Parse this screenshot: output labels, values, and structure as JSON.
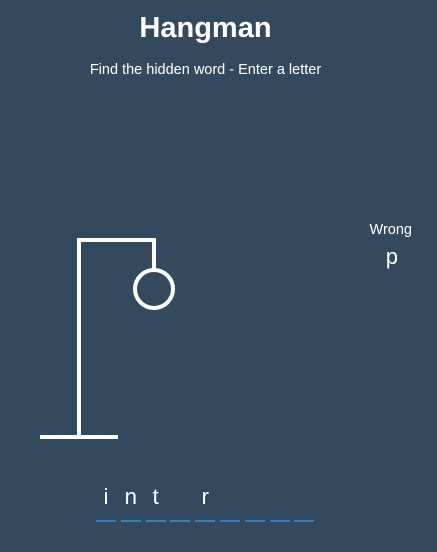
{
  "header": {
    "title": "Hangman",
    "subtitle": "Find the hidden word - Enter a letter"
  },
  "wrong": {
    "label": "Wrong",
    "letters": "p"
  },
  "word": {
    "slots": [
      "i",
      "n",
      "t",
      "",
      "r",
      "",
      "",
      "",
      "",
      ""
    ]
  },
  "colors": {
    "background": "#34495e",
    "text": "#ffffff",
    "dash": "#2f80c1"
  }
}
